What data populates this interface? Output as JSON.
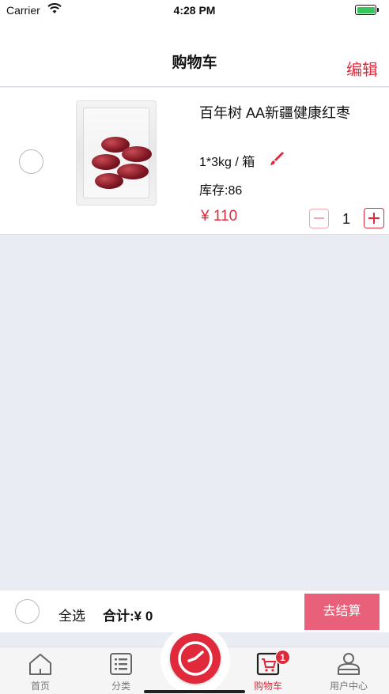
{
  "status_bar": {
    "carrier": "Carrier",
    "time": "4:28 PM"
  },
  "header": {
    "title": "购物车",
    "edit_label": "编辑"
  },
  "cart": {
    "items": [
      {
        "name": "百年树 AA新疆健康红枣",
        "spec": "1*3kg / 箱",
        "stock": "库存:86",
        "price": "¥ 110",
        "quantity": "1"
      }
    ]
  },
  "checkout": {
    "select_all_label": "全选",
    "total_label": "合计:",
    "total_value": "¥ 0",
    "checkout_button": "去结算"
  },
  "tabbar": {
    "tabs": [
      {
        "label": "首页",
        "icon": "home-icon"
      },
      {
        "label": "分类",
        "icon": "list-icon"
      },
      {
        "label": "购物车",
        "icon": "cart-icon",
        "badge": "1"
      },
      {
        "label": "用户中心",
        "icon": "user-icon"
      }
    ],
    "center_icon": "clock-icon"
  },
  "colors": {
    "accent": "#e02a3b",
    "checkout_button": "#e8607a",
    "background": "#e9ecf3"
  }
}
